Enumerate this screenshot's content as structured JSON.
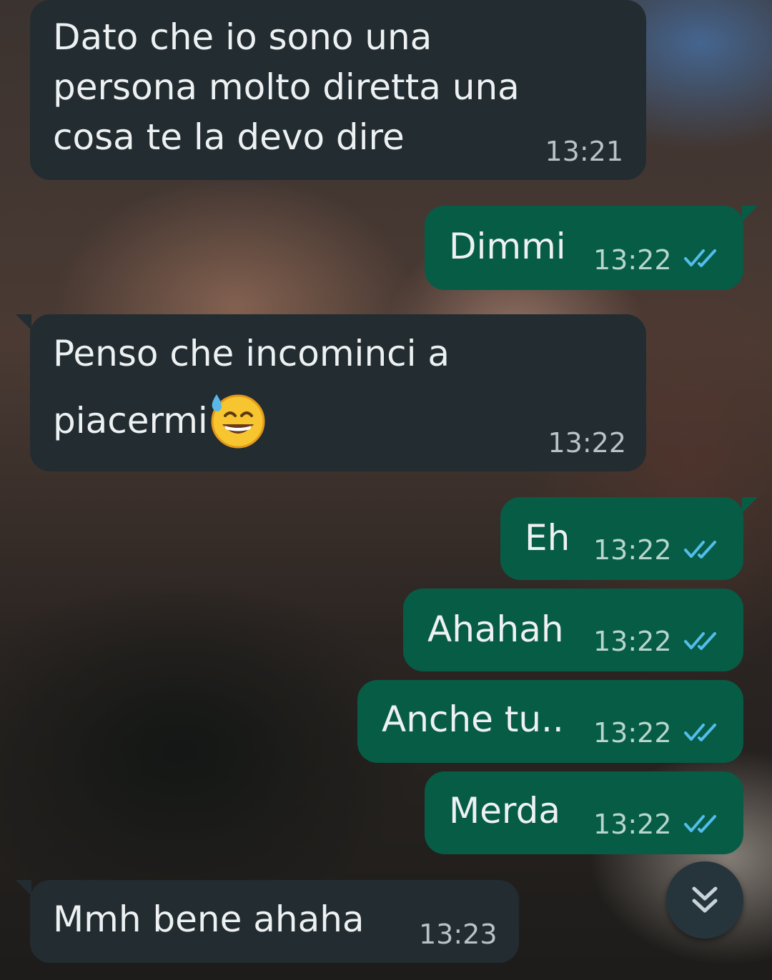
{
  "messages": [
    {
      "direction": "incoming",
      "lines": [
        "Dato che io sono una",
        "persona molto diretta una",
        "cosa te la devo dire"
      ],
      "time": "13:21"
    },
    {
      "direction": "outgoing",
      "text": "Dimmi",
      "time": "13:22",
      "status": "read"
    },
    {
      "direction": "incoming",
      "lines": [
        "Penso che incominci a",
        "piacermi"
      ],
      "emoji": "grinning-face-with-sweat",
      "time": "13:22"
    },
    {
      "direction": "outgoing",
      "text": "Eh",
      "time": "13:22",
      "status": "read"
    },
    {
      "direction": "outgoing",
      "text": "Ahahah",
      "time": "13:22",
      "status": "read"
    },
    {
      "direction": "outgoing",
      "text": "Anche tu..",
      "time": "13:22",
      "status": "read"
    },
    {
      "direction": "outgoing",
      "text": "Merda",
      "time": "13:22",
      "status": "read"
    },
    {
      "direction": "incoming",
      "text": "Mmh bene ahaha",
      "time": "13:23"
    }
  ],
  "colors": {
    "incoming_bubble": "#222c31",
    "outgoing_bubble": "#075c46",
    "read_ticks": "#53bdeb",
    "scroll_button": "#26343b"
  },
  "icons": {
    "read_receipt": "double-check-icon",
    "scroll_to_bottom": "chevron-double-down-icon"
  }
}
